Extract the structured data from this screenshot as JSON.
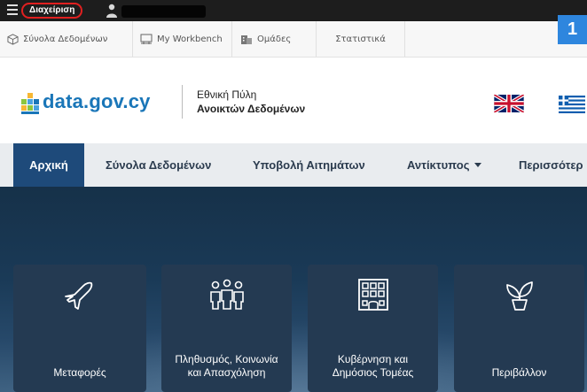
{
  "admin_bar": {
    "admin_label": "Διαχείριση",
    "badge_number": "1"
  },
  "sub_toolbar": {
    "items": [
      {
        "label": "Σύνολα Δεδομένων",
        "icon": "box-icon"
      },
      {
        "label": "My Workbench",
        "icon": "workbench-icon"
      },
      {
        "label": "Ομάδες",
        "icon": "groups-icon"
      },
      {
        "label": "Στατιστικά",
        "icon": ""
      }
    ]
  },
  "brand": {
    "logo_text": "data.gov.cy",
    "portal_line1": "Εθνική Πύλη",
    "portal_line2": "Ανοικτών Δεδομένων"
  },
  "nav": {
    "items": [
      {
        "label": "Αρχική",
        "active": true
      },
      {
        "label": "Σύνολα Δεδομένων"
      },
      {
        "label": "Υποβολή Αιτημάτων"
      },
      {
        "label": "Αντίκτυπος",
        "dropdown": true
      },
      {
        "label": "Περισσότερ"
      }
    ]
  },
  "categories": [
    {
      "label": "Μεταφορές",
      "icon": "airplane-icon"
    },
    {
      "label": "Πληθυσμός, Κοινωνία και Απασχόληση",
      "icon": "people-icon"
    },
    {
      "label": "Κυβέρνηση και Δημόσιος Τομέας",
      "icon": "building-icon"
    },
    {
      "label": "Περιβάλλον",
      "icon": "plant-icon"
    }
  ],
  "colors": {
    "admin_bar": "#1d1d1d",
    "highlight": "#e02020",
    "brand_blue": "#1a76b8",
    "nav_active": "#1e4a7a",
    "badge": "#2e86de",
    "card": "#243a52"
  }
}
